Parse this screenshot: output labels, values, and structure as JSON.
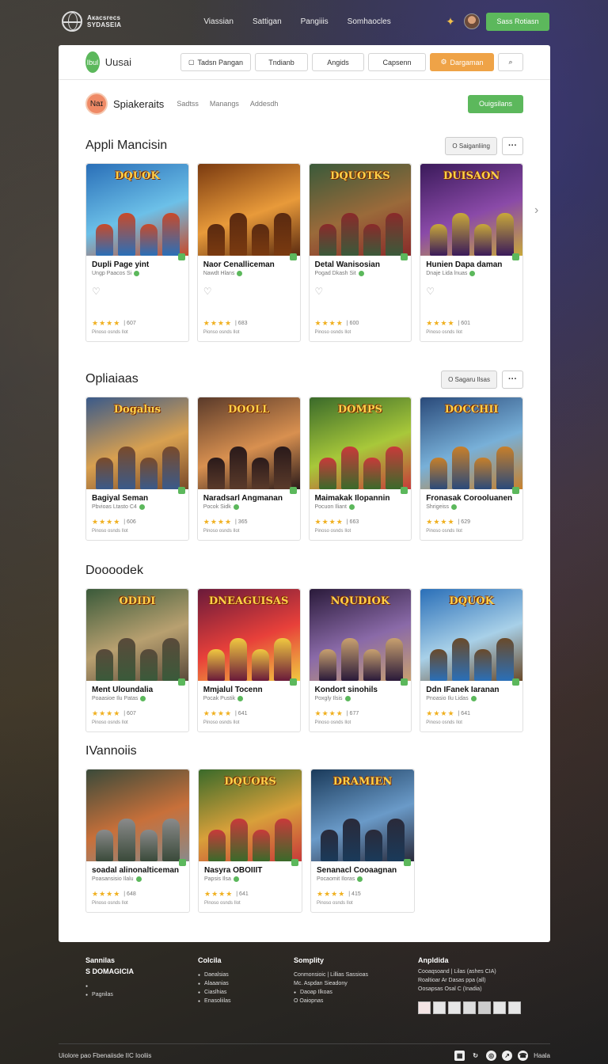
{
  "topnav": {
    "brand_line1": "Aкacsrecs",
    "brand_line2": "SYDASEIA",
    "links": [
      "Viassian",
      "Sattigan",
      "Pangiiis",
      "Somhaocles"
    ],
    "cta": "Sass Rotiasn"
  },
  "header": {
    "logo_text": "Ibul",
    "title": "Uusai",
    "toolbar": [
      "Tadsn Pangan",
      "Tndianb",
      "Angids",
      "Capsenn",
      "Dargaman"
    ]
  },
  "subheader": {
    "avatar_text": "Naɪ",
    "title": "Spiakeraits",
    "tabs": [
      "Sadtss",
      "Manangs",
      "Addesdh"
    ],
    "button": "Ouigsilans"
  },
  "sections": [
    {
      "title": "Appli Mancisin",
      "action": "O Saiganliing",
      "cards": [
        {
          "thumb": "DQUOK",
          "title": "Dupli Page yint",
          "sub": "Ungp Paacos Si",
          "rating": "| 607",
          "meta": "Pinoso osnds Ilot",
          "colors": [
            "#2a6fb8",
            "#6cc0e8",
            "#c84a2a"
          ]
        },
        {
          "thumb": "",
          "title": "Naor Cenalliceman",
          "sub": "Nawdt Hlans",
          "rating": "| 683",
          "meta": "Pionso osnds Ilot",
          "colors": [
            "#7a3a10",
            "#e89a3a",
            "#5a2a10"
          ]
        },
        {
          "thumb": "DQUOTKS",
          "title": "Detal Wanisosian",
          "sub": "Pogad Dkash Sit",
          "rating": "| 600",
          "meta": "Pinoso osnds Ilot",
          "colors": [
            "#3a5a3a",
            "#9a6a3a",
            "#8a2a2a"
          ]
        },
        {
          "thumb": "DUISAON",
          "title": "Hunien Dapa daman",
          "sub": "Dnaje Lida lnuas",
          "rating": "| 601",
          "meta": "Pinoso osnds Ilot",
          "colors": [
            "#3a1a5a",
            "#8a4aa8",
            "#c8a83a"
          ]
        }
      ]
    },
    {
      "title": "Opliaiaas",
      "action": "O Sagaru Ilsas",
      "cards": [
        {
          "thumb": "Dogalus",
          "title": "Bagiyal Seman",
          "sub": "Pbvioas Ltasto C4",
          "rating": "| 606",
          "meta": "Pinoso osnds Ilot",
          "colors": [
            "#3a5a8a",
            "#d8a050",
            "#7a4a2a"
          ]
        },
        {
          "thumb": "DOOLL",
          "title": "Naradsarl Angmanan",
          "sub": "Pocok Sidk",
          "rating": "| 365",
          "meta": "Pinoso osnds Ilot",
          "colors": [
            "#5a3a2a",
            "#d89050",
            "#2a1a1a"
          ]
        },
        {
          "thumb": "DOMPS",
          "title": "Maimakak Ilopannin",
          "sub": "Pocuon Iliant",
          "rating": "| 663",
          "meta": "Pinoso osnds Ilot",
          "colors": [
            "#3a6a2a",
            "#a8c83a",
            "#c83a3a"
          ]
        },
        {
          "thumb": "DOCCHII",
          "title": "Fronasak Corooluanen",
          "sub": "Shrigeiss",
          "rating": "| 629",
          "meta": "Pinoso osnds Ilot",
          "colors": [
            "#2a4a7a",
            "#78b0d8",
            "#c8802a"
          ]
        }
      ]
    },
    {
      "title": "Doooodek",
      "action": "",
      "cards": [
        {
          "thumb": "ODIDI",
          "title": "Ment Uloundalia",
          "sub": "Poaasioe Ilu Patas",
          "rating": "| 607",
          "meta": "Pinoso osnds Ilot",
          "colors": [
            "#3a5a3a",
            "#b8a070",
            "#5a4a3a"
          ]
        },
        {
          "thumb": "DNEAGUISAS",
          "title": "Mmjalul Tocenn",
          "sub": "Pocak Pustik",
          "rating": "| 641",
          "meta": "Pinoso osnds Ilot",
          "colors": [
            "#6a1a3a",
            "#e8403a",
            "#f0c840"
          ]
        },
        {
          "thumb": "NQUDIOK",
          "title": "Kondort sinohils",
          "sub": "Poxgly Ilsis",
          "rating": "| 677",
          "meta": "Pinoso osnds Ilot",
          "colors": [
            "#2a1a3a",
            "#8a6aa8",
            "#c8a070"
          ]
        },
        {
          "thumb": "DQUOK",
          "title": "Ddn IFanek Iaranan",
          "sub": "Pnoasio Ilu Lidas",
          "rating": "| 641",
          "meta": "Pinoso osnds Ilot",
          "colors": [
            "#2a6fb8",
            "#a8d0e8",
            "#6a4a2a"
          ]
        }
      ]
    },
    {
      "title": "IVannoiis",
      "action": "",
      "cards": [
        {
          "thumb": "",
          "title": "soadal alinonalticeman",
          "sub": "Poasansisio Ilalu",
          "rating": "| 648",
          "meta": "Pinoso osnds Ilot",
          "colors": [
            "#3a4a3a",
            "#c8703a",
            "#8a8a8a"
          ]
        },
        {
          "thumb": "DQUORS",
          "title": "Nasyra OBOIIIT",
          "sub": "Papsis Ilsa",
          "rating": "| 641",
          "meta": "Pinoso osnds Ilot",
          "colors": [
            "#3a6a2a",
            "#d8a03a",
            "#c83a3a"
          ]
        },
        {
          "thumb": "DRAMIEN",
          "title": "Senanacl Cooaagnan",
          "sub": "Pocaomit Iloras",
          "rating": "| 415",
          "meta": "Pinoso osnds Ilot",
          "colors": [
            "#1a3a5a",
            "#6a9ac8",
            "#2a2a3a"
          ]
        }
      ]
    }
  ],
  "footer": {
    "col1": {
      "h1": "Sannilas",
      "h2": "S DOMAGICIA",
      "items": [
        "",
        "Pagnilas"
      ]
    },
    "col2": {
      "h": "Colcila",
      "items": [
        "Daealsias",
        "Alaaanias",
        "Ciaslhias",
        "Enasoliilas"
      ]
    },
    "col3": {
      "h": "Somplity",
      "items": [
        "Conmonsioic | Lillias Sassioas",
        "Mc. Aspdan Sieadony",
        "Daoap Ilkoas",
        "O Oaiopnas"
      ]
    },
    "col4": {
      "h": "Anpldida",
      "items": [
        "Cooaqsoand | Lilas (ashes CIA)",
        "Roaltioar Ar Dasas ppa (all)",
        "Oosapsas Osal C (Inadia)"
      ]
    },
    "bottom_left": "Uiolore pao  Fbenaiisde IIC Iooliis",
    "bottom_right": "Haala"
  }
}
